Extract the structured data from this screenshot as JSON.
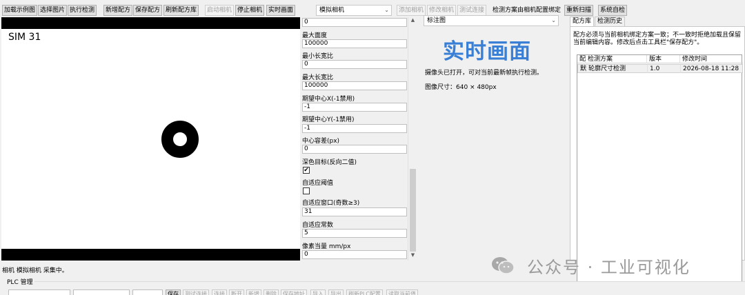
{
  "toolbar": {
    "buttons": [
      {
        "label": "加载示例图",
        "enabled": true
      },
      {
        "label": "选择图片",
        "enabled": true
      },
      {
        "label": "执行检测",
        "enabled": true
      },
      {
        "label": "新增配方",
        "enabled": true
      },
      {
        "label": "保存配方",
        "enabled": true
      },
      {
        "label": "刷新配方库",
        "enabled": true
      },
      {
        "label": "启动相机",
        "enabled": false
      },
      {
        "label": "停止相机",
        "enabled": true
      },
      {
        "label": "实时画面",
        "enabled": true
      },
      {
        "label": "添加相机",
        "enabled": false
      },
      {
        "label": "修改相机",
        "enabled": false
      },
      {
        "label": "测试连接",
        "enabled": false
      },
      {
        "label": "重新扫描",
        "enabled": true
      },
      {
        "label": "系统自检",
        "enabled": true
      }
    ],
    "camera_select": "模拟相机",
    "binding_label": "检测方案由相机配置绑定"
  },
  "camera_view": {
    "overlay_text": "SIM 31"
  },
  "params": {
    "partial_top_value": "0",
    "fields": [
      {
        "label": "最大面度",
        "value": "100000",
        "kind": "text"
      },
      {
        "label": "最小长宽比",
        "value": "0",
        "kind": "text"
      },
      {
        "label": "最大长宽比",
        "value": "100000",
        "kind": "text"
      },
      {
        "label": "期望中心X(-1禁用)",
        "value": "-1",
        "kind": "text"
      },
      {
        "label": "期望中心Y(-1禁用)",
        "value": "-1",
        "kind": "text"
      },
      {
        "label": "中心容差(px)",
        "value": "0",
        "kind": "text"
      },
      {
        "label": "深色目标(反向二值)",
        "value": "✔",
        "kind": "check"
      },
      {
        "label": "自适应阈值",
        "value": "",
        "kind": "check"
      },
      {
        "label": "自适应窗口(奇数≥3)",
        "value": "31",
        "kind": "text"
      },
      {
        "label": "自适应常数",
        "value": "5",
        "kind": "text"
      },
      {
        "label": "像素当量 mm/px",
        "value": "0",
        "kind": "text"
      }
    ]
  },
  "live": {
    "view_select": "标注图",
    "title": "实时画面",
    "message": "摄像头已打开，可对当前最新帧执行检测。",
    "image_size": "图像尺寸：640 × 480px"
  },
  "recipe": {
    "tabs": [
      "配方库",
      "检测历史"
    ],
    "note": "配方必须与当前相机绑定方案一致；不一致时拒绝加载且保留当前编辑内容。修改后点击工具栏\"保存配方\"。",
    "columns": [
      "配",
      "检测方案",
      "版本",
      "修改时间"
    ],
    "rows": [
      {
        "flag": "默",
        "name": "轮廓尺寸检测",
        "version": "1.0",
        "modified": "2026-08-18 11:28"
      }
    ]
  },
  "status": {
    "text": "相机 模拟相机 采集中。"
  },
  "plc": {
    "title": "PLC 管理",
    "buttons": [
      {
        "label": "保存",
        "enabled": true
      },
      {
        "label": "测试连接",
        "enabled": false
      },
      {
        "label": "连接",
        "enabled": false
      },
      {
        "label": "断开",
        "enabled": false
      },
      {
        "label": "新增",
        "enabled": false
      },
      {
        "label": "删除",
        "enabled": false
      },
      {
        "label": "保存地址",
        "enabled": false
      },
      {
        "label": "导入",
        "enabled": false
      },
      {
        "label": "导出",
        "enabled": false
      },
      {
        "label": "刷新PLC配置",
        "enabled": false
      },
      {
        "label": "读取当前值",
        "enabled": false
      }
    ]
  },
  "watermark": {
    "text": "公众号 · 工业可视化"
  },
  "colors": {
    "accent": "#3a7fd6"
  }
}
